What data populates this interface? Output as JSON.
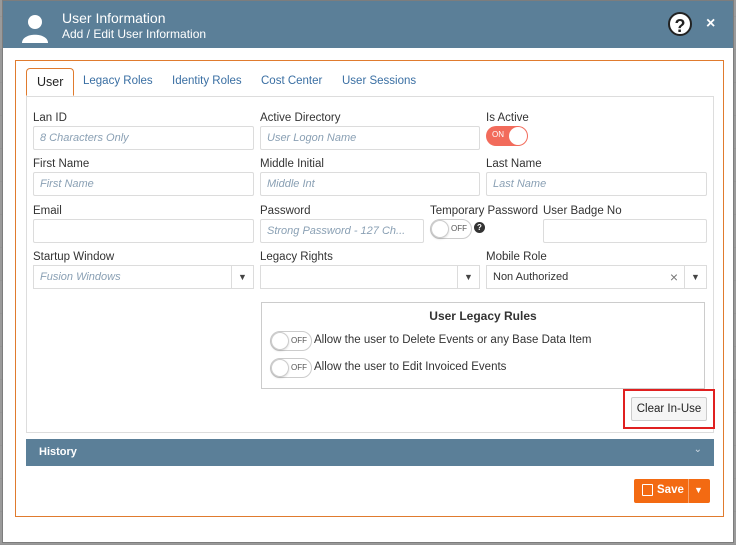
{
  "dialog": {
    "title": "User Information",
    "subtitle": "Add / Edit User Information",
    "help_icon": "?",
    "close_icon": "×"
  },
  "tabs": [
    {
      "label": "User",
      "active": true
    },
    {
      "label": "Legacy Roles",
      "active": false
    },
    {
      "label": "Identity Roles",
      "active": false
    },
    {
      "label": "Cost Center",
      "active": false
    },
    {
      "label": "User Sessions",
      "active": false
    }
  ],
  "form": {
    "lan_id": {
      "label": "Lan ID",
      "placeholder": "8 Characters Only",
      "value": ""
    },
    "active_directory": {
      "label": "Active Directory",
      "placeholder": "User Logon Name",
      "value": ""
    },
    "is_active": {
      "label": "Is Active",
      "state": "ON"
    },
    "first_name": {
      "label": "First Name",
      "placeholder": "First Name",
      "value": ""
    },
    "middle_initial": {
      "label": "Middle Initial",
      "placeholder": "Middle Int",
      "value": ""
    },
    "last_name": {
      "label": "Last Name",
      "placeholder": "Last Name",
      "value": ""
    },
    "email": {
      "label": "Email",
      "placeholder": "",
      "value": ""
    },
    "password": {
      "label": "Password",
      "placeholder": "Strong Password - 127 Ch...",
      "value": ""
    },
    "temporary_password": {
      "label": "Temporary Password",
      "state": "OFF",
      "help": "?"
    },
    "user_badge_no": {
      "label": "User Badge No",
      "value": ""
    },
    "startup_window": {
      "label": "Startup Window",
      "placeholder": "Fusion Windows",
      "value": ""
    },
    "legacy_rights": {
      "label": "Legacy Rights",
      "value": ""
    },
    "mobile_role": {
      "label": "Mobile Role",
      "value": "Non Authorized",
      "clear": "×"
    }
  },
  "legacy_rules": {
    "title": "User Legacy Rules",
    "rules": [
      {
        "label": "Allow the user to Delete Events or any Base Data Item",
        "state": "OFF"
      },
      {
        "label": "Allow the user to Edit Invoiced Events",
        "state": "OFF"
      }
    ]
  },
  "buttons": {
    "clear_in_use": "Clear In-Use",
    "save": "Save",
    "dropdown_caret": "▼"
  },
  "history": {
    "label": "History",
    "chevron": "⌄"
  },
  "colors": {
    "header": "#5b7f98",
    "accent_orange": "#f36a12",
    "toggle_on": "#f26b5b",
    "highlight_red": "#e02020",
    "link_blue": "#3a6fa3"
  }
}
